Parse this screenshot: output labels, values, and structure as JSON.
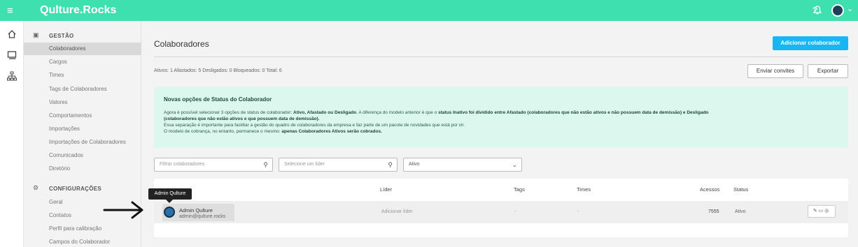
{
  "topbar": {
    "menu_icon": "hamburger-icon",
    "brand": "Qulture.Rocks",
    "icons": [
      "help-icon",
      "bell-icon",
      "avatar",
      "chevron-down-icon"
    ]
  },
  "iconrail": {
    "icons": [
      "home-icon",
      "chat-icon",
      "org-chart-icon"
    ]
  },
  "sidebar": {
    "section_gestao": {
      "title": "GESTÃO",
      "icon": "people-icon"
    },
    "gestao_items": [
      "Colaboradores",
      "Cargos",
      "Times",
      "Tags de Colaboradores",
      "Valores",
      "Comportamentos",
      "Importações",
      "Importações de Colaboradores",
      "Comunicados",
      "Diretório"
    ],
    "section_config": {
      "title": "CONFIGURAÇÕES",
      "icon": "gear-icon"
    },
    "config_items": [
      "Geral",
      "Contatos",
      "Perfil para calibração",
      "Campos do Colaborador"
    ],
    "active_item": "Colaboradores"
  },
  "main": {
    "title": "Colaboradores",
    "add_button": "Adicionar colaborador",
    "counts": "Ativos: 1  Afastados: 5  Desligados: 0  Bloqueados: 0  Total: 6",
    "send_invites": "Enviar convites",
    "export": "Exportar",
    "notice": {
      "title": "Novas opções de Status do Colaborador",
      "p1_a": "Agora é possível selecionar 3 opções de status de colaborador: ",
      "p1_b": "Ativo, Afastado ou Desligado",
      "p1_c": ". A diferença do modelo anterior é que o ",
      "p1_d": "status Inativo foi dividido entre Afastado (colaboradores que não estão ativos e não possuem data de demissão) e Desligado",
      "p2": "(colaboradores que não estão ativos e que possuem data de demissão).",
      "p3": "Essa separação é importante para facilitar a gestão do quadro de colaboradores da empresa e faz parte de um pacote de novidades que está por vir.",
      "p4_a": "O modelo de cobrança, no entanto, permanece o mesmo: ",
      "p4_b": "apenas Colaboradores Ativos serão cobrados."
    },
    "filters": {
      "search_placeholder": "Filtrar colaboradores",
      "leader_placeholder": "Selecione um líder",
      "status_value": "Ativo"
    },
    "table": {
      "headers": {
        "leader": "Líder",
        "tags": "Tags",
        "times": "Times",
        "acessos": "Acessos",
        "status": "Status"
      },
      "rows": [
        {
          "name": "Admin Qulture",
          "email": "admin@qulture.rocks",
          "leader": "Adicionar líder",
          "tags": "-",
          "times": "-",
          "acessos": "7555",
          "status": "Ativo",
          "actions": [
            "edit-icon",
            "message-icon",
            "view-icon"
          ]
        }
      ]
    },
    "tooltip": "Admin Qulture"
  },
  "colors": {
    "topbar": "#3fe0b0",
    "primary_button": "#18b6f2",
    "notice_bg": "#dcf8ee"
  }
}
